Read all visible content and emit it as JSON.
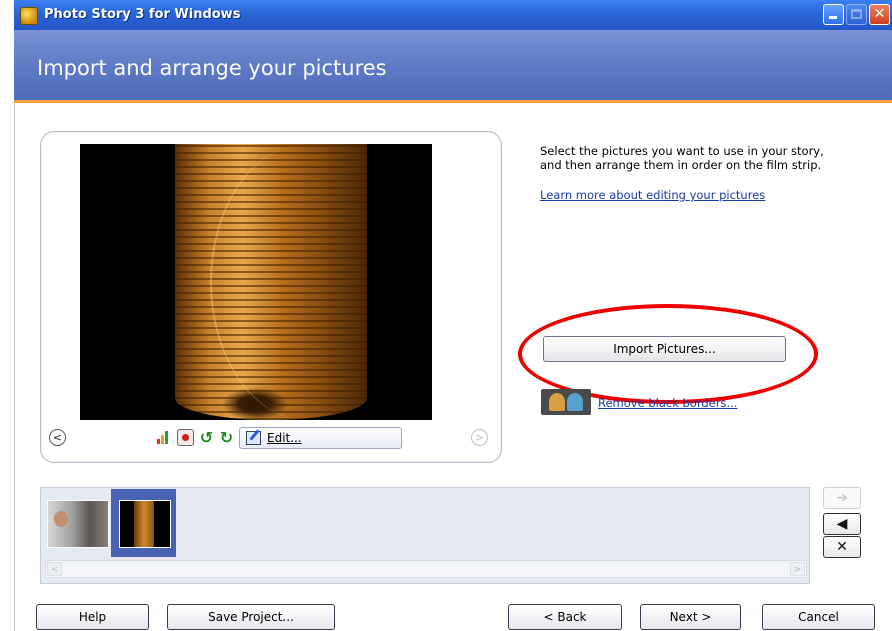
{
  "window": {
    "title": "Photo Story 3 for Windows",
    "controls": {
      "minimize": "minimize-icon",
      "maximize": "maximize-icon",
      "close_glyph": "✕"
    }
  },
  "header": {
    "title": "Import and arrange your pictures"
  },
  "preview": {
    "image": "high-rise atrium photo",
    "tools": {
      "prev_glyph": "<",
      "next_glyph": ">",
      "rotate_left_glyph": "↺",
      "rotate_right_glyph": "↻",
      "edit_label": "Edit..."
    }
  },
  "instructions": {
    "text": "Select the pictures you want to use in your story, and then arrange them in order on the film strip.",
    "learn_more_link": "Learn more about editing your pictures"
  },
  "import_button": {
    "label": "Import Pictures..."
  },
  "remove_borders": {
    "label": "Remove black borders..."
  },
  "filmstrip": {
    "thumbnails": [
      {
        "name": "person-photo-thumbnail",
        "selected": false
      },
      {
        "name": "atrium-photo-thumbnail",
        "selected": true
      }
    ],
    "scroll_left_glyph": "<",
    "scroll_right_glyph": ">",
    "move_right_glyph": "➔",
    "move_left_glyph": "◀",
    "delete_glyph": "✕"
  },
  "buttons": {
    "help": "Help",
    "save_project": "Save Project...",
    "back": "< Back",
    "next": "Next >",
    "cancel": "Cancel"
  },
  "colors": {
    "titlebar": "#2a68d8",
    "header": "#5c79c4",
    "header_accent": "#f0a23a",
    "highlight": "#ee0000",
    "link": "#1a3aa8",
    "selected_thumb": "#4a62b4"
  }
}
